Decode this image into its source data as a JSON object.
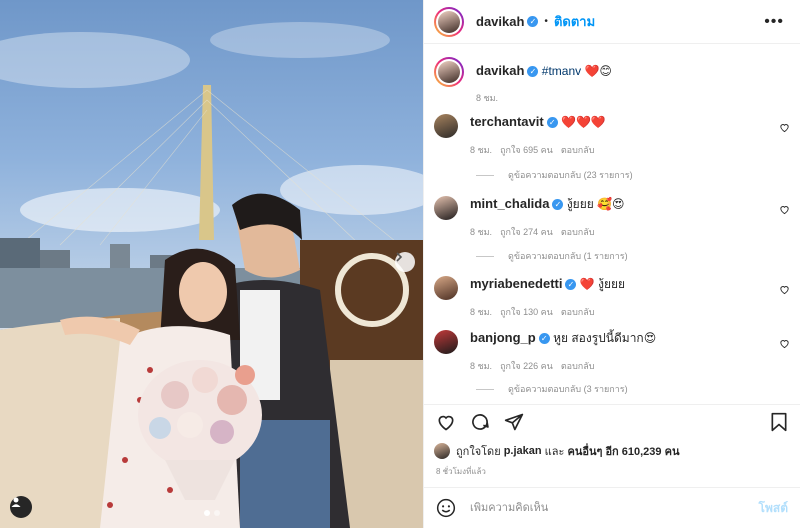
{
  "header": {
    "username": "davikah",
    "separator": "•",
    "follow_label": "ติดตาม",
    "more_label": "•••"
  },
  "caption": {
    "username": "davikah",
    "text": "#tmanv",
    "emoji": "❤️😊",
    "time": "8 ชม."
  },
  "comments": [
    {
      "username": "terchantavit",
      "text": "",
      "emoji": "❤️❤️❤️",
      "time": "8 ชม.",
      "likes": "ถูกใจ 695 คน",
      "reply_label": "ตอบกลับ",
      "replies": "ดูข้อความตอบกลับ (23 รายการ)"
    },
    {
      "username": "mint_chalida",
      "text": "งู้ยยย",
      "emoji": "🥰😍",
      "time": "8 ชม.",
      "likes": "ถูกใจ 274 คน",
      "reply_label": "ตอบกลับ",
      "replies": "ดูข้อความตอบกลับ (1 รายการ)"
    },
    {
      "username": "myriabenedetti",
      "text": "งู้ยยย",
      "emoji": "❤️",
      "time": "8 ชม.",
      "likes": "ถูกใจ 130 คน",
      "reply_label": "ตอบกลับ",
      "replies": ""
    },
    {
      "username": "banjong_p",
      "text": "หูย สองรูปนี้ดีมาก",
      "emoji": "😍",
      "time": "8 ชม.",
      "likes": "ถูกใจ 226 คน",
      "reply_label": "ตอบกลับ",
      "replies": "ดูข้อความตอบกลับ (3 รายการ)"
    }
  ],
  "likes_line": {
    "prefix": "ถูกใจโดย",
    "user": "p.jakan",
    "conj": "และ",
    "others": "คนอื่นๆ อีก 610,239 คน"
  },
  "posted_ago": "8 ชั่วโมงที่แล้ว",
  "add_comment": {
    "placeholder": "เพิ่มความคิดเห็น",
    "post_label": "โพสต์"
  },
  "carousel": {
    "current": 1,
    "total": 2
  },
  "colors": {
    "accent": "#0095f6",
    "heart": "#ed1c24",
    "muted": "#8e8e8e",
    "verified": "#3897f0"
  }
}
